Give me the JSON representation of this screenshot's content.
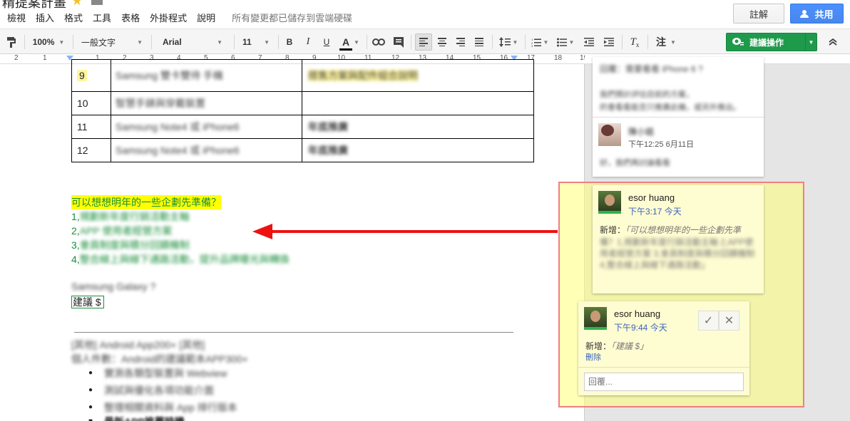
{
  "header": {
    "doc_title": "精提案計畫",
    "menu": [
      "檢視",
      "插入",
      "格式",
      "工具",
      "表格",
      "外掛程式",
      "說明"
    ],
    "save_status": "所有變更都已儲存到雲端硬碟",
    "comments_label": "註解",
    "share_label": "共用"
  },
  "toolbar": {
    "zoom": "100%",
    "style": "一般文字",
    "font": "Arial",
    "size": "11",
    "bold": "B",
    "italic": "I",
    "underline": "U",
    "text_color": "A",
    "notes_label": "注",
    "suggest_label": "建議操作",
    "text_color_value": "#000000",
    "accent_color": "#1e9a4b"
  },
  "ruler": {
    "ticks": [
      "2",
      "1",
      "1",
      "2",
      "3",
      "4",
      "5",
      "6",
      "7",
      "8",
      "9",
      "10",
      "11",
      "12",
      "13",
      "14",
      "15",
      "16",
      "17",
      "18",
      "19"
    ]
  },
  "document": {
    "table_rows": [
      {
        "num": "9",
        "c2": "Samsung 雙卡雙待 手機",
        "c3": "搭售方案與配件組合說明"
      },
      {
        "num": "10",
        "c2": "智慧手錶與穿戴裝置",
        "c3": ""
      },
      {
        "num": "11",
        "c2": "Samsung Note4 或 iPhone6",
        "c3": "年底推廣"
      },
      {
        "num": "12",
        "c2": "Samsung Note4 或 iPhone6",
        "c3": "年底推廣"
      }
    ],
    "question": "可以想想明年的一些企劃先準備？",
    "items": [
      {
        "n": "1,",
        "text": "規劃新年度行銷活動主軸"
      },
      {
        "n": "2,",
        "text": "APP 使用者經營方案"
      },
      {
        "n": "3,",
        "text": "會員制度與積分回饋機制"
      },
      {
        "n": "4,",
        "text": "整合線上與線下通路活動，提升品牌曝光與轉換"
      }
    ],
    "galaxy_line": "Samsung Galaxy ?",
    "suggestion_text": "建議 $",
    "section_title": "[其他] Android App200+ [其他]",
    "section_sub": "個人件數：Android的建議範本APP300+",
    "bullets": [
      "實測各類型裝置與 Webview",
      "測試與優化各項功能介面",
      "整理相關資料與 App 排行版本",
      "最新APP推薦時機"
    ]
  },
  "sidebar": {
    "top_card": {
      "line1": "回覆：需要看看 iPhone 6 ?",
      "line2": "我們預計評估目前的方案，",
      "line3": "的會看看能否只推廣此機，或另外推出。",
      "avatar_alt": "使用者",
      "reply_name": "陳小姐",
      "reply_time": "下午12:25 6月11日",
      "reply_text": "好，我們再討論看看"
    },
    "comment1": {
      "author": "esor huang",
      "time": "下午3:17 今天",
      "add_prefix": "新增：",
      "add_text": "「可以想想明年的一些企劃先準",
      "body": "備？1,規劃新年度行銷活動主軸 2,APP使用者經營方案 3,會員制度與積分回饋機制 4,整合線上與線下通路活動」"
    },
    "comment2": {
      "author": "esor huang",
      "time": "下午9:44 今天",
      "add_prefix": "新增：",
      "add_text": "「建議 $」",
      "delete": "刪除",
      "reply_placeholder": "回覆..."
    }
  }
}
